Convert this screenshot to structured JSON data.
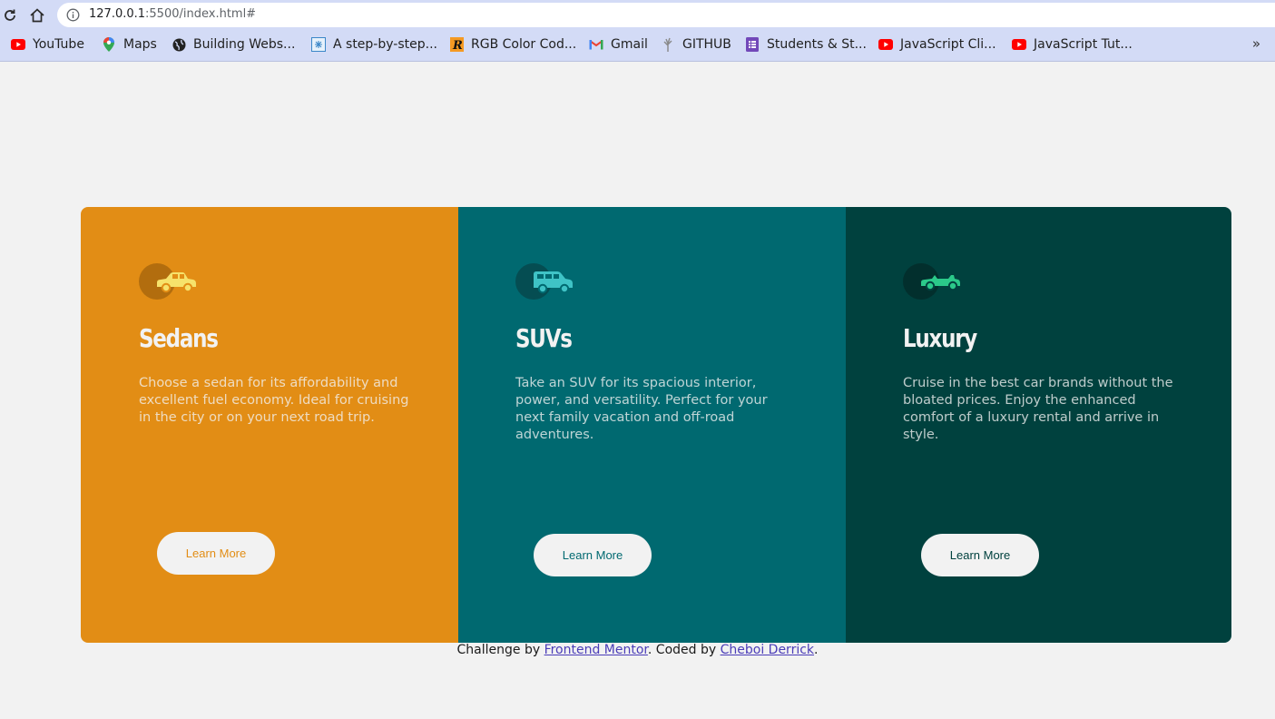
{
  "browser": {
    "url_host": "127.0.0.1",
    "url_rest": ":5500/index.html#",
    "bookmarks": [
      {
        "label": "YouTube",
        "icon": "youtube-icon"
      },
      {
        "label": "Maps",
        "icon": "maps-icon"
      },
      {
        "label": "Building Webs...",
        "icon": "globe-icon"
      },
      {
        "label": "A step-by-step...",
        "icon": "grid-icon"
      },
      {
        "label": "RGB Color Cod...",
        "icon": "r-logo-icon"
      },
      {
        "label": "Gmail",
        "icon": "gmail-icon"
      },
      {
        "label": "GITHUB",
        "icon": "tree-icon"
      },
      {
        "label": "Students & St...",
        "icon": "forms-icon"
      },
      {
        "label": "JavaScript Cli...",
        "icon": "youtube-icon"
      },
      {
        "label": "JavaScript Tut...",
        "icon": "youtube-icon"
      }
    ],
    "more_label": "»"
  },
  "columns": [
    {
      "title": "Sedans",
      "text": "Choose a sedan for its affordability and excellent fuel economy. Ideal for cruising in the city or on your next road trip.",
      "button": "Learn More",
      "icon": "sedan-car-icon",
      "bg": "#e28d15",
      "accent": "#f6e26b"
    },
    {
      "title": "SUVs",
      "text": "Take an SUV for its spacious interior, power, and versatility. Perfect for your next family vacation and off-road adventures.",
      "button": "Learn More",
      "icon": "suv-car-icon",
      "bg": "#006970",
      "accent": "#3fc3c6"
    },
    {
      "title": "Luxury",
      "text": "Cruise in the best car brands without the bloated prices. Enjoy the enhanced comfort of a luxury rental and arrive in style.",
      "button": "Learn More",
      "icon": "luxury-car-icon",
      "bg": "#00413e",
      "accent": "#2bc98a"
    }
  ],
  "footer": {
    "prefix": "Challenge by ",
    "link1": "Frontend Mentor",
    "middle": ". Coded by ",
    "link2": "Cheboi Derrick",
    "suffix": "."
  }
}
